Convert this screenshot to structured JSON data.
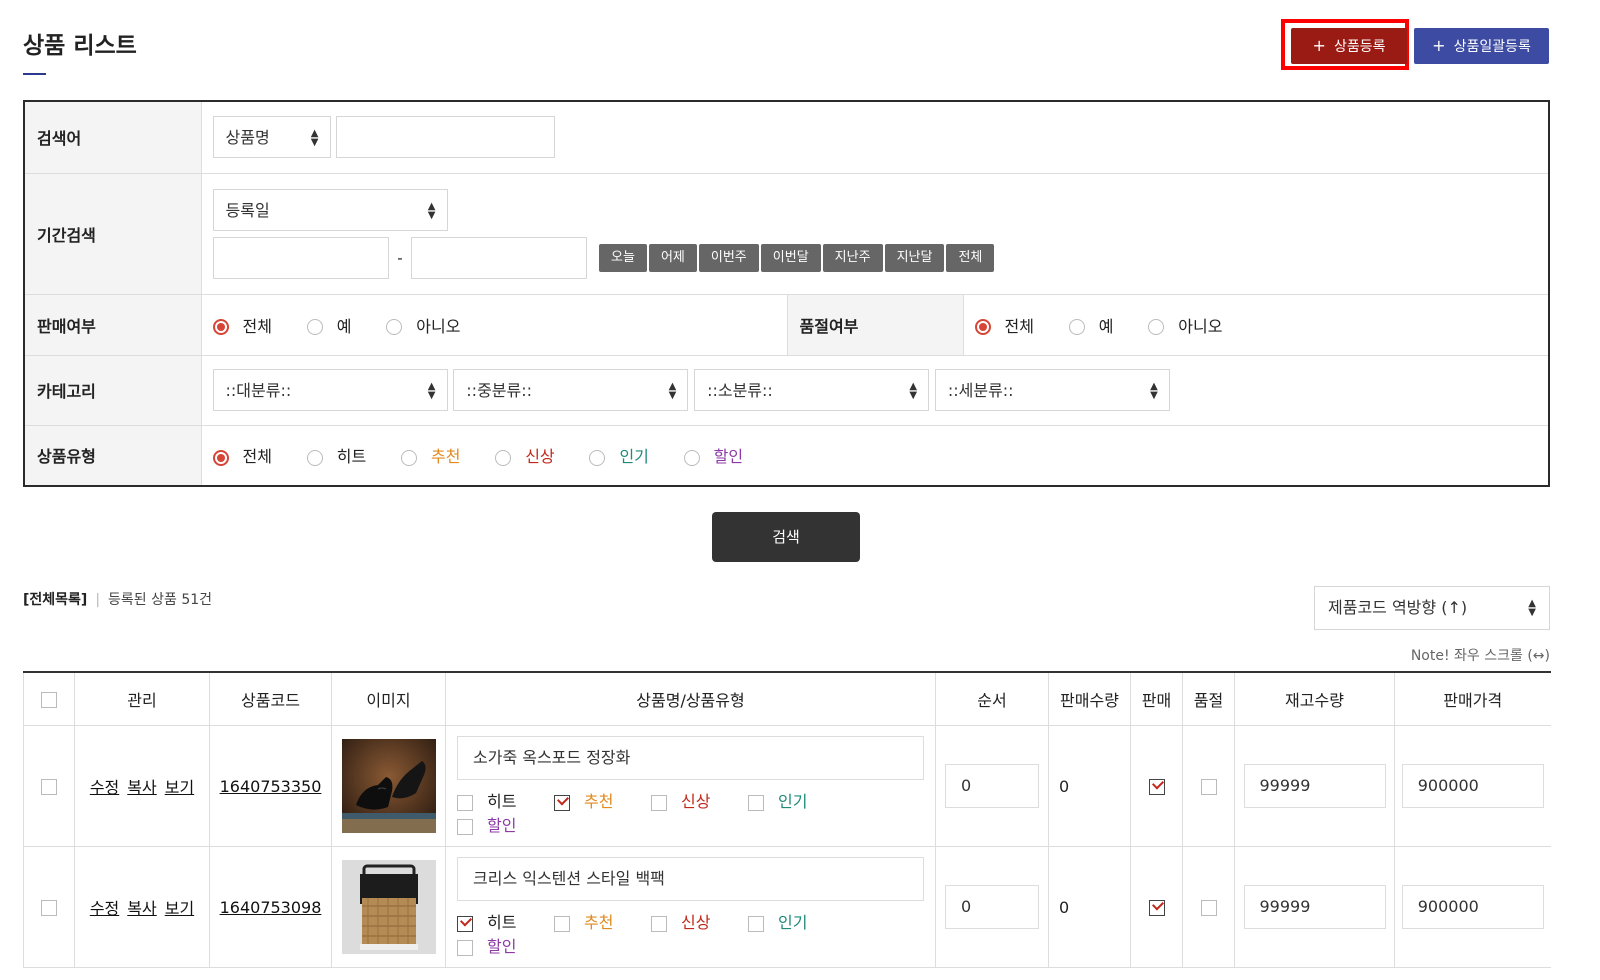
{
  "page": {
    "title": "상품 리스트"
  },
  "top_buttons": {
    "register": "상품등록",
    "bulk_register": "상품일괄등록",
    "plus": "+"
  },
  "search": {
    "keyword": {
      "label": "검색어",
      "field_select": "상품명",
      "value": ""
    },
    "period": {
      "label": "기간검색",
      "date_type": "등록일",
      "start": "",
      "end": "",
      "dash": "-",
      "quick_buttons": [
        "오늘",
        "어제",
        "이번주",
        "이번달",
        "지난주",
        "지난달",
        "전체"
      ]
    },
    "on_sale": {
      "label": "판매여부",
      "options": [
        "전체",
        "예",
        "아니오"
      ],
      "selected": "전체"
    },
    "sold_out": {
      "label": "품절여부",
      "options": [
        "전체",
        "예",
        "아니오"
      ],
      "selected": "전체"
    },
    "category": {
      "label": "카테고리",
      "selects": [
        "::대분류::",
        "::중분류::",
        "::소분류::",
        "::세분류::"
      ]
    },
    "product_type": {
      "label": "상품유형",
      "options": [
        "전체",
        "히트",
        "추천",
        "신상",
        "인기",
        "할인"
      ],
      "selected": "전체"
    },
    "submit": "검색"
  },
  "summary": {
    "all_list": "[전체목록]",
    "divider": "|",
    "count_text": "등록된 상품 51건"
  },
  "sort": {
    "selected": "제품코드 역방향 (↑)"
  },
  "note": "Note! 좌우 스크롤 (↔)",
  "table": {
    "headers": [
      "관리",
      "상품코드",
      "이미지",
      "상품명/상품유형",
      "순서",
      "판매수량",
      "판매",
      "품절",
      "재고수량",
      "판매가격"
    ],
    "actions": [
      "수정",
      "복사",
      "보기"
    ],
    "type_labels": [
      "히트",
      "추천",
      "신상",
      "인기",
      "할인"
    ],
    "rows": [
      {
        "code": "1640753350",
        "name": "소가죽 옥스포드 정장화",
        "image": "black-oxford-shoes",
        "types_checked": [
          false,
          true,
          false,
          false,
          false
        ],
        "order": "0",
        "sold_qty": "0",
        "on_sale": true,
        "sold_out": false,
        "stock": "99999",
        "price": "900000"
      },
      {
        "code": "1640753098",
        "name": "크리스 익스텐션 스타일 백팩",
        "image": "woven-backpack",
        "types_checked": [
          true,
          false,
          false,
          false,
          false
        ],
        "order": "0",
        "sold_qty": "0",
        "on_sale": true,
        "sold_out": false,
        "stock": "99999",
        "price": "900000"
      }
    ]
  },
  "colors": {
    "register_btn": "#9a1b14",
    "bulk_btn": "#3d4ba3",
    "highlight": "#ff0000",
    "recommend": "#e28a1f",
    "new": "#c0281b",
    "popular": "#1e8a7a",
    "sale": "#8e3aa6"
  }
}
